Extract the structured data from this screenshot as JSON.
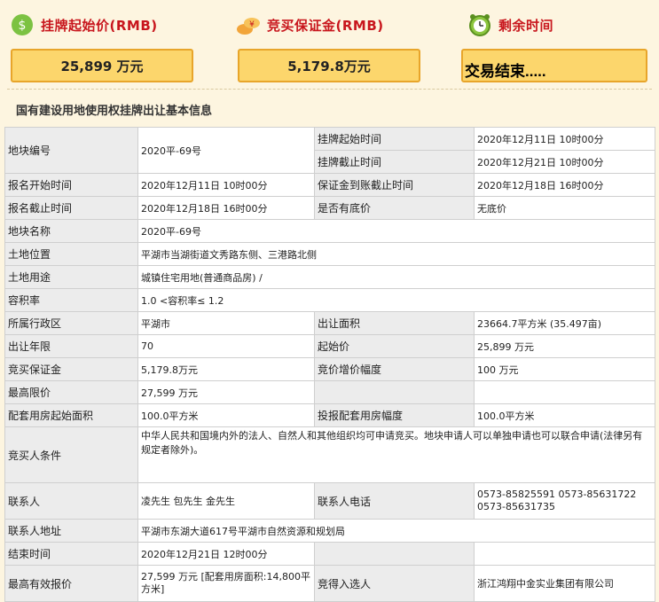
{
  "header": {
    "start_price_label": "挂牌起始价(RMB)",
    "deposit_label": "竞买保证金(RMB)",
    "remaining_label": "剩余时间",
    "start_price_value": "25,899 万元",
    "deposit_value": "5,179.8万元",
    "remaining_value": "交易结束....."
  },
  "section_title": "国有建设用地使用权挂牌出让基本信息",
  "table": {
    "plot_no_label": "地块编号",
    "plot_no": "2020平-69号",
    "listing_start_label": "挂牌起始时间",
    "listing_start": "2020年12月11日 10时00分",
    "listing_end_label": "挂牌截止时间",
    "listing_end": "2020年12月21日 10时00分",
    "apply_start_label": "报名开始时间",
    "apply_start": "2020年12月11日 10时00分",
    "deposit_deadline_label": "保证金到账截止时间",
    "deposit_deadline": "2020年12月18日 16时00分",
    "apply_end_label": "报名截止时间",
    "apply_end": "2020年12月18日 16时00分",
    "reserve_label": "是否有底价",
    "reserve": "无底价",
    "plot_name_label": "地块名称",
    "plot_name": "2020平-69号",
    "location_label": "土地位置",
    "location": "平湖市当湖街道文秀路东侧、三港路北侧",
    "usage_label": "土地用途",
    "usage": "城镇住宅用地(普通商品房) /",
    "far_label": "容积率",
    "far": "1.0 <容积率≤ 1.2",
    "district_label": "所属行政区",
    "district": "平湖市",
    "area_label": "出让面积",
    "area": "23664.7平方米 (35.497亩)",
    "term_label": "出让年限",
    "term": "70",
    "start_price_label": "起始价",
    "start_price": "25,899 万元",
    "deposit_label": "竞买保证金",
    "deposit": "5,179.8万元",
    "increment_label": "竞价增价幅度",
    "increment": "100 万元",
    "max_price_label": "最高限价",
    "max_price": "27,599 万元",
    "aux_area_label": "配套用房起始面积",
    "aux_area": "100.0平方米",
    "aux_increment_label": "投报配套用房幅度",
    "aux_increment": "100.0平方米",
    "conditions_label": "竞买人条件",
    "conditions": "中华人民共和国境内外的法人、自然人和其他组织均可申请竞买。地块申请人可以单独申请也可以联合申请(法律另有规定者除外)。",
    "contact_label": "联系人",
    "contact": "凌先生 包先生 金先生",
    "phone_label": "联系人电话",
    "phone": "0573-85825591 0573-85631722 0573-85631735",
    "address_label": "联系人地址",
    "address": "平湖市东湖大道617号平湖市自然资源和规划局",
    "end_time_label": "结束时间",
    "end_time": "2020年12月21日 12时00分",
    "best_price_label": "最高有效报价",
    "best_price": "27,599 万元 [配套用房面积:14,800平方米]",
    "winner_label": "竞得入选人",
    "winner": "浙江鸿翔中金实业集团有限公司"
  },
  "colors": {
    "accent_red": "#c8161d",
    "box_fill": "#fcd66c",
    "box_border": "#e8a52a"
  },
  "icons": [
    "money-icon",
    "coins-icon",
    "alarm-clock-icon"
  ]
}
